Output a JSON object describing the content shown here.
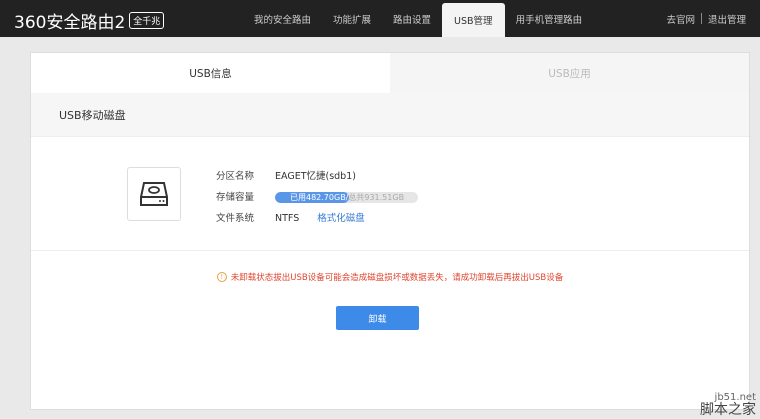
{
  "header": {
    "logo": "360安全路由2",
    "logo_badge": "全千兆",
    "nav": [
      {
        "label": "我的安全路由"
      },
      {
        "label": "功能扩展"
      },
      {
        "label": "路由设置"
      },
      {
        "label": "USB管理"
      },
      {
        "label": "用手机管理路由"
      }
    ],
    "links": {
      "official": "去官网",
      "logout": "退出管理"
    }
  },
  "tabs": [
    {
      "label": "USB信息"
    },
    {
      "label": "USB应用"
    }
  ],
  "section_title": "USB移动磁盘",
  "disk": {
    "name_label": "分区名称",
    "name": "EAGET忆捷(sdb1)",
    "capacity_label": "存储容量",
    "used_text": "已用482.70GB/",
    "total_text": "总共931.51GB",
    "used_fraction": 0.518,
    "fs_label": "文件系统",
    "fs": "NTFS",
    "format_link": "格式化磁盘"
  },
  "warning": "未卸载状态拔出USB设备可能会造成磁盘损坏或数据丢失，请成功卸载后再拔出USB设备",
  "unmount_button": "卸载",
  "watermark": {
    "site": "jb51.net",
    "name": "脚本之家"
  },
  "colors": {
    "accent": "#3d8ae8",
    "warning": "#e0452e"
  }
}
